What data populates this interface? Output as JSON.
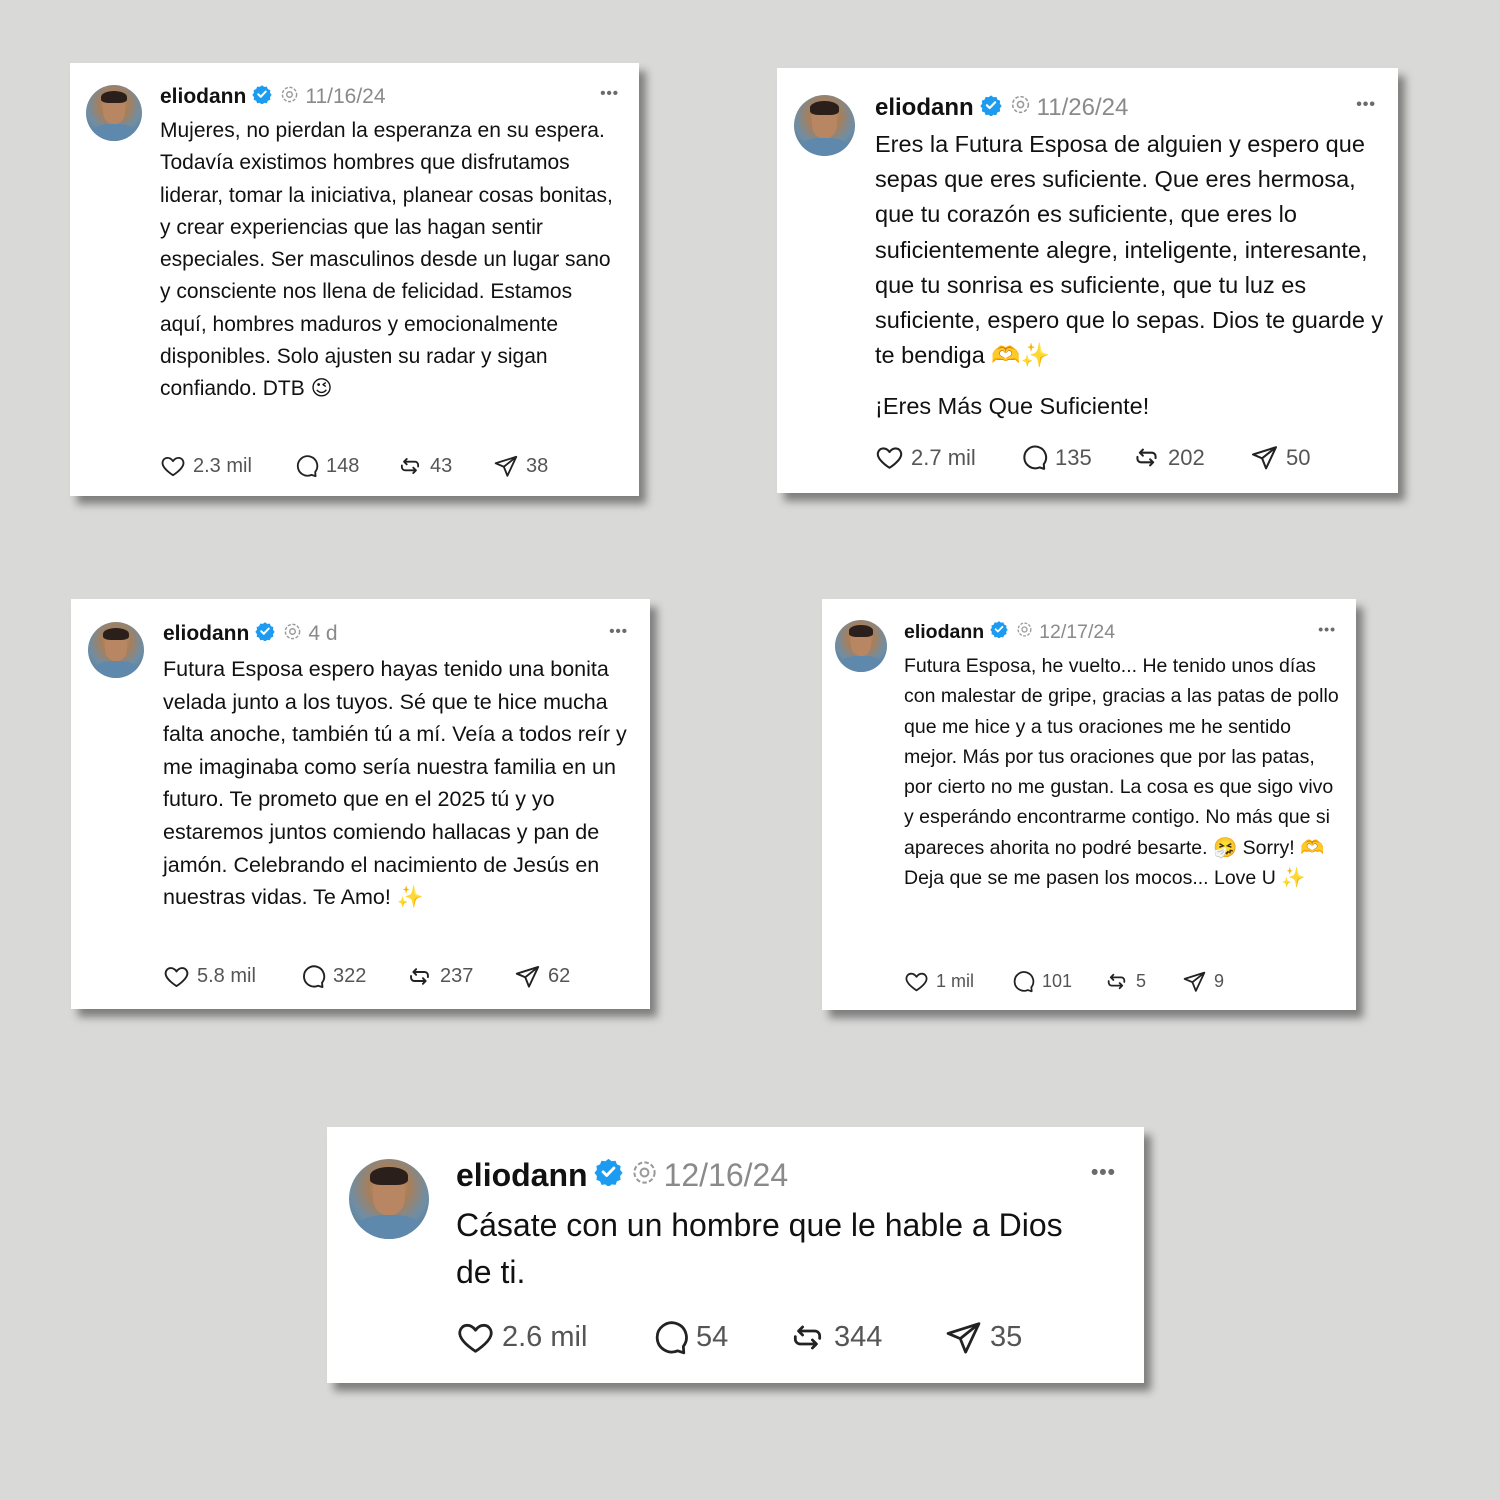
{
  "colors": {
    "background": "#d9d9d8",
    "verified": "#1d9bf0",
    "meta": "#8a8a8a"
  },
  "posts": [
    {
      "username": "eliodann",
      "date": "11/16/24",
      "more": "•••",
      "text": "Mujeres, no pierdan la esperanza en su espera. Todavía existimos hombres que disfrutamos liderar, tomar la iniciativa, planear cosas bonitas, y crear experiencias que las hagan sentir especiales. Ser masculinos desde un lugar sano y consciente nos llena de felicidad. Estamos aquí, hombres maduros y emocionalmente disponibles. Solo ajusten su radar y sigan confiando. DTB 😉",
      "likes": "2.3 mil",
      "replies": "148",
      "reposts": "43",
      "shares": "38"
    },
    {
      "username": "eliodann",
      "date": "11/26/24",
      "more": "•••",
      "text": "Eres la Futura Esposa de alguien y espero que sepas que eres suficiente. Que eres hermosa, que tu corazón es suficiente, que eres lo suficientemente alegre, inteligente, interesante, que tu sonrisa es suficiente, que tu luz es suficiente, espero que lo sepas. Dios te guarde y te bendiga 🫶✨",
      "text2": "¡Eres Más Que Suficiente!",
      "likes": "2.7 mil",
      "replies": "135",
      "reposts": "202",
      "shares": "50"
    },
    {
      "username": "eliodann",
      "date": "4 d",
      "more": "•••",
      "text": "Futura Esposa espero hayas tenido una bonita velada junto a los tuyos. Sé que te hice mucha falta anoche, también tú a mí. Veía a todos reír y me imaginaba como sería nuestra familia en un futuro. Te prometo que en el 2025 tú y yo estaremos juntos comiendo hallacas y pan de jamón. Celebrando el nacimiento de Jesús en nuestras vidas. Te Amo! ✨",
      "likes": "5.8 mil",
      "replies": "322",
      "reposts": "237",
      "shares": "62"
    },
    {
      "username": "eliodann",
      "date": "12/17/24",
      "more": "•••",
      "text": "Futura Esposa, he vuelto... He tenido unos días con malestar de gripe, gracias a las patas de pollo que me hice y a tus oraciones me he sentido mejor. Más por tus oraciones que por las patas, por cierto no me gustan. La cosa es que sigo vivo y esperándo encontrarme contigo. No más que si apareces ahorita no podré besarte. 🤧 Sorry! 🫶 Deja que se me pasen los mocos... Love U ✨",
      "likes": "1 mil",
      "replies": "101",
      "reposts": "5",
      "shares": "9"
    },
    {
      "username": "eliodann",
      "date": "12/16/24",
      "more": "•••",
      "text": "Cásate con un hombre que le hable a Dios de ti.",
      "likes": "2.6 mil",
      "replies": "54",
      "reposts": "344",
      "shares": "35"
    }
  ]
}
